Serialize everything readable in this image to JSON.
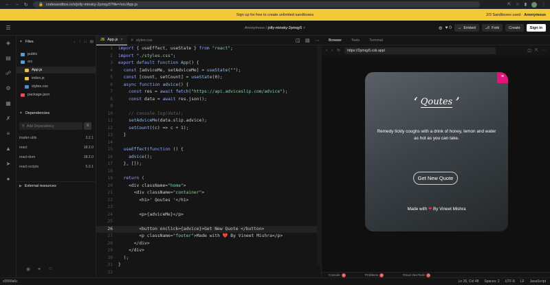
{
  "browser": {
    "url": "codesandbox.io/s/jolly-minsky-2pmqy5?file=/src/App.js"
  },
  "banner": {
    "message": "Sign up for free to create unlimited sandboxes",
    "sandboxes_used": "2/3 Sandboxes used ·",
    "user": "Anonymous"
  },
  "header": {
    "owner": "Anonymous /",
    "sandbox_name": "jolly-minsky-2pmqy5",
    "likes": "0",
    "embed": "Embed",
    "fork": "Fork",
    "create": "Create",
    "sign_in": "Sign in"
  },
  "sidebar": {
    "files_title": "Files",
    "tree": [
      {
        "name": "public",
        "kind": "folder"
      },
      {
        "name": "src",
        "kind": "folder"
      },
      {
        "name": "App.js",
        "kind": "js"
      },
      {
        "name": "index.js",
        "kind": "js"
      },
      {
        "name": "styles.css",
        "kind": "css"
      },
      {
        "name": "package.json",
        "kind": "json"
      }
    ],
    "dependencies_title": "Dependencies",
    "add_dependency_placeholder": "Add Dependency",
    "dependencies": [
      {
        "name": "loader-utils",
        "version": "3.2.1"
      },
      {
        "name": "react",
        "version": "18.2.0"
      },
      {
        "name": "react-dom",
        "version": "18.2.0"
      },
      {
        "name": "react-scripts",
        "version": "5.0.1"
      }
    ],
    "external_title": "External resources"
  },
  "editor": {
    "tabs": [
      {
        "label": "App.js",
        "badge": "JS"
      },
      {
        "label": "styles.css",
        "badge": "#"
      }
    ],
    "lines": [
      {
        "n": "1",
        "code": "import { useEffect, useState } from \"react\";"
      },
      {
        "n": "2",
        "code": "import \"./styles.css\";"
      },
      {
        "n": "3",
        "code": "export default function App() {"
      },
      {
        "n": "4",
        "code": "  const [adviceMe, setAdviceMe] = useState(\"\");"
      },
      {
        "n": "5",
        "code": "  const [count, setCount] = useState(0);"
      },
      {
        "n": "6",
        "code": "  async function advice() {"
      },
      {
        "n": "7",
        "code": "    const res = await fetch(\"https://api.adviceslip.com/advice\");"
      },
      {
        "n": "8",
        "code": "    const data = await res.json();"
      },
      {
        "n": "9",
        "code": ""
      },
      {
        "n": "10",
        "code": "    // console.log(data);"
      },
      {
        "n": "11",
        "code": "    setAdviceMe(data.slip.advice);"
      },
      {
        "n": "12",
        "code": "    setCount((c) => c + 1);"
      },
      {
        "n": "13",
        "code": "  }"
      },
      {
        "n": "14",
        "code": ""
      },
      {
        "n": "15",
        "code": "  useEffect(function () {"
      },
      {
        "n": "16",
        "code": "    advice();"
      },
      {
        "n": "17",
        "code": "  }, []);"
      },
      {
        "n": "18",
        "code": ""
      },
      {
        "n": "19",
        "code": "  return ("
      },
      {
        "n": "20",
        "code": "    <div className=\"home\">"
      },
      {
        "n": "21",
        "code": "      <div className=\"container\">"
      },
      {
        "n": "22",
        "code": "        <h1>' Qoutes '</h1>"
      },
      {
        "n": "23",
        "code": ""
      },
      {
        "n": "24",
        "code": "        <p>{adviceMe}</p>"
      },
      {
        "n": "25",
        "code": ""
      },
      {
        "n": "26",
        "code": "        <button onclick={advice}>Get New Quote </button>"
      },
      {
        "n": "27",
        "code": "        <p className=\"footer\">Made with ❤️ By Vineet Mishra</p>"
      },
      {
        "n": "28",
        "code": "      </div>"
      },
      {
        "n": "29",
        "code": "    </div>"
      },
      {
        "n": "30",
        "code": "  );"
      },
      {
        "n": "31",
        "code": "}"
      },
      {
        "n": "32",
        "code": ""
      }
    ]
  },
  "preview": {
    "tabs": [
      "Browser",
      "Tests",
      "Terminal"
    ],
    "url": "https://2pmqy5.csb.app/",
    "card": {
      "quote_mark": "”",
      "title": "Qoutes",
      "title_open": "‘",
      "title_close": "’",
      "advice": "Remedy tickly coughs with a drink of honey, lemon and water as hot as you can take.",
      "button": "Get New Quote",
      "footer_prefix": "Made with",
      "footer_heart": "❤",
      "footer_suffix": "By Vineet Mishra"
    },
    "bottom_tabs": [
      {
        "label": "Console",
        "count": "0"
      },
      {
        "label": "Problems",
        "count": "0"
      },
      {
        "label": "React DevTools",
        "count": "0"
      }
    ]
  },
  "status": {
    "branch": "c0558a6c",
    "cursor": "Ln 26, Col 48",
    "spaces": "Spaces: 2",
    "encoding": "UTF-8",
    "eol": "LF",
    "language": "JavaScript"
  },
  "colors": {
    "banner": "#f5c83a",
    "accent_pink": "#e0147a",
    "heart": "#e53935"
  }
}
